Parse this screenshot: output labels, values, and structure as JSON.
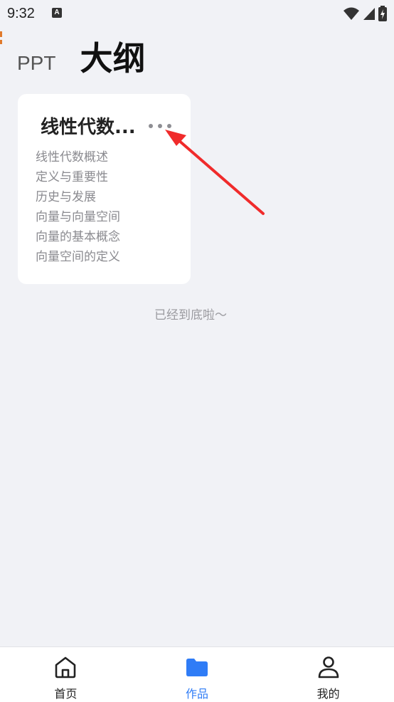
{
  "status_bar": {
    "time": "9:32",
    "notification_icon": "a-letter-icon",
    "icons": [
      "wifi-icon",
      "signal-icon",
      "battery-charging-icon"
    ]
  },
  "header": {
    "tabs": [
      {
        "label": "PPT",
        "active": false
      },
      {
        "label": "大纲",
        "active": true
      }
    ]
  },
  "card": {
    "title": "线性代数...",
    "menu_icon": "more-horizontal-icon",
    "lines": [
      "线性代数概述",
      "定义与重要性",
      "历史与发展",
      "向量与向量空间",
      "向量的基本概念",
      "向量空间的定义"
    ]
  },
  "end_text": "已经到底啦～",
  "annotation": {
    "icon": "red-arrow-pointing-to-menu",
    "color": "#f02b2b"
  },
  "bottom_nav": {
    "items": [
      {
        "label": "首页",
        "icon": "home-icon",
        "active": false
      },
      {
        "label": "作品",
        "icon": "folder-icon",
        "active": true
      },
      {
        "label": "我的",
        "icon": "user-icon",
        "active": false
      }
    ]
  },
  "colors": {
    "background": "#f1f2f6",
    "accent": "#2f7cf6",
    "card": "#ffffff"
  }
}
